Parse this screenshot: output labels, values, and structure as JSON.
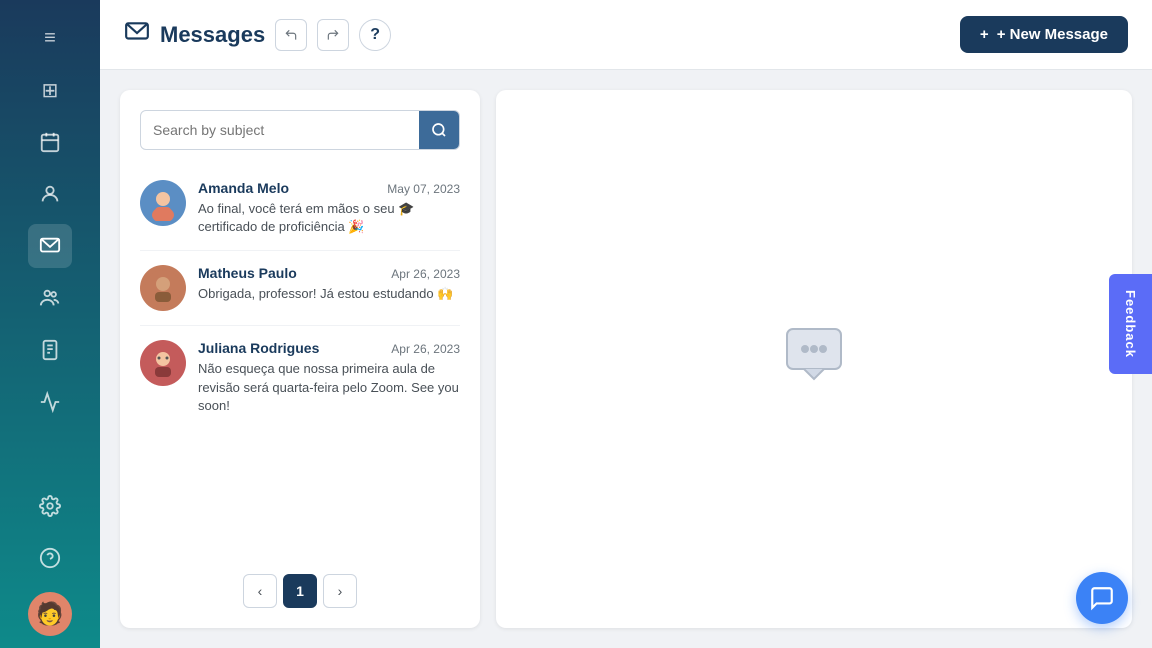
{
  "sidebar": {
    "icons": [
      {
        "name": "collapse-icon",
        "symbol": "≡",
        "active": false
      },
      {
        "name": "dashboard-icon",
        "symbol": "⊞",
        "active": false
      },
      {
        "name": "calendar-icon",
        "symbol": "📅",
        "active": false
      },
      {
        "name": "contacts-icon",
        "symbol": "👤",
        "active": false
      },
      {
        "name": "messages-icon",
        "symbol": "💬",
        "active": true
      },
      {
        "name": "students-icon",
        "symbol": "👥",
        "active": false
      },
      {
        "name": "assignments-icon",
        "symbol": "📋",
        "active": false
      },
      {
        "name": "reports-icon",
        "symbol": "📊",
        "active": false
      },
      {
        "name": "settings-icon",
        "symbol": "⚙",
        "active": false
      },
      {
        "name": "help-icon",
        "symbol": "?",
        "active": false
      }
    ],
    "avatar_emoji": "🧑"
  },
  "header": {
    "icon": "💬",
    "title": "Messages",
    "undo_label": "↩",
    "redo_label": "↪",
    "help_label": "?",
    "new_message_label": "+ New Message"
  },
  "search": {
    "placeholder": "Search by subject"
  },
  "messages": [
    {
      "sender": "Amanda Melo",
      "date": "May 07, 2023",
      "preview": "Ao final, você terá em mãos o seu 🎓certificado de proficiência 🎉",
      "avatar_emoji": "👩",
      "avatar_color": "#5b8ec4"
    },
    {
      "sender": "Matheus Paulo",
      "date": "Apr 26, 2023",
      "preview": "Obrigada, professor! Já estou estudando 🙌",
      "avatar_emoji": "🧑",
      "avatar_color": "#c47b5b"
    },
    {
      "sender": "Juliana Rodrigues",
      "date": "Apr 26, 2023",
      "preview": "Não esqueça que nossa primeira aula de revisão será quarta-feira pelo Zoom. See you soon!",
      "avatar_emoji": "👩",
      "avatar_color": "#c45b5b"
    }
  ],
  "pagination": {
    "prev_label": "‹",
    "current_page": "1",
    "next_label": "›"
  },
  "feedback": {
    "label": "Feedback"
  },
  "chat_fab": {
    "icon": "💬"
  }
}
